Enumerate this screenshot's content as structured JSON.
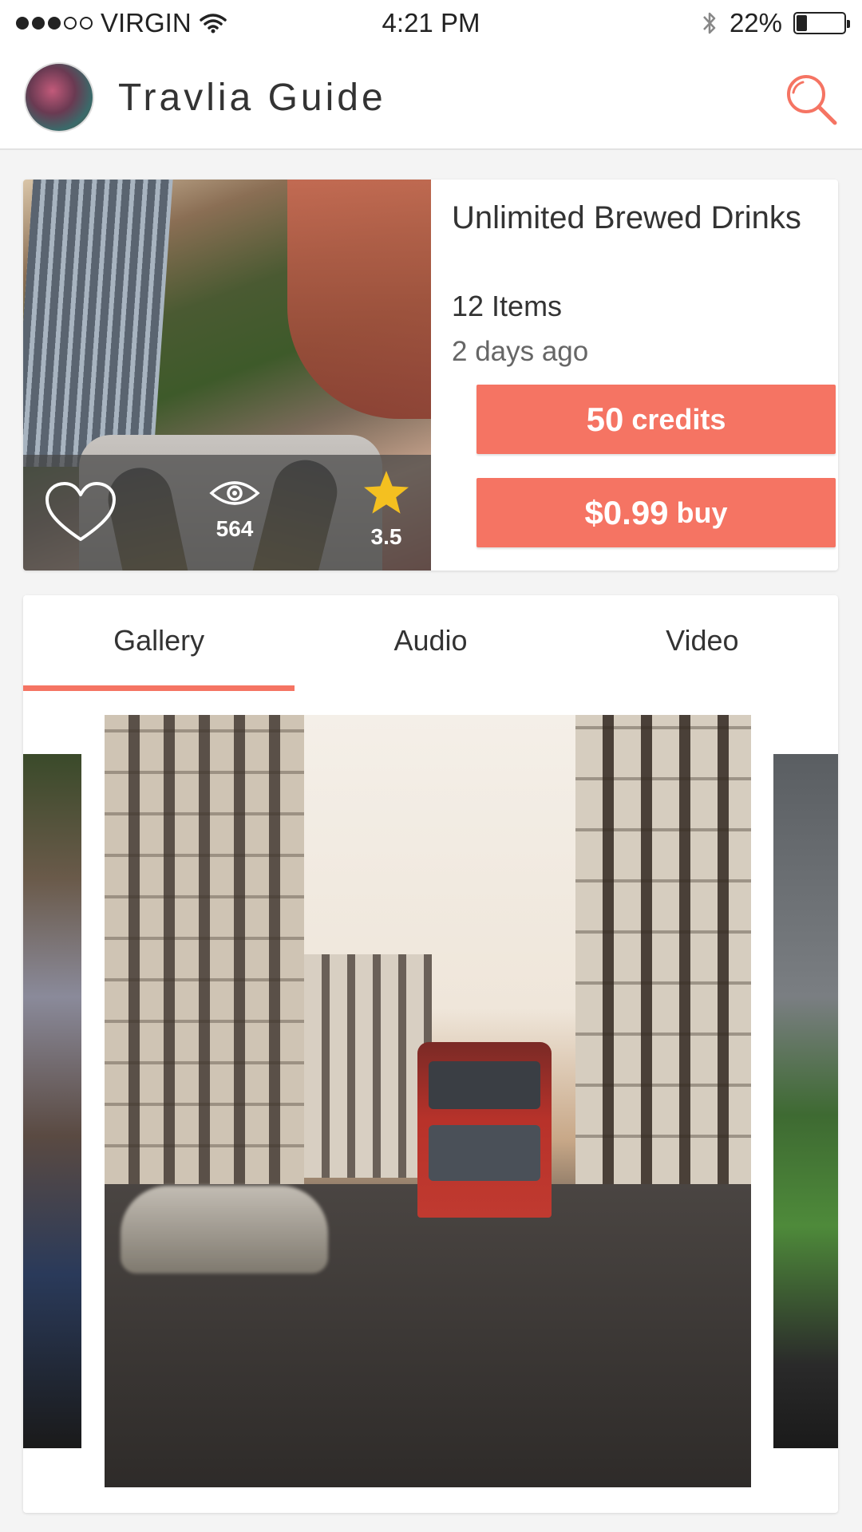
{
  "status_bar": {
    "signal_filled": 3,
    "signal_total": 5,
    "carrier": "VIRGIN",
    "time": "4:21 PM",
    "battery": "22%",
    "battery_level": 0.22
  },
  "header": {
    "title": "Travlia Guide",
    "search_icon": "search-icon",
    "avatar_icon": "avatar"
  },
  "product": {
    "title": "Unlimited Brewed Drinks",
    "items": "12 Items",
    "posted": "2 days ago",
    "views": "564",
    "rating": "3.5",
    "credits_value": "50",
    "credits_unit": "credits",
    "price_value": "$0.99",
    "price_unit": "buy"
  },
  "tabs": [
    {
      "label": "Gallery",
      "active": true
    },
    {
      "label": "Audio",
      "active": false
    },
    {
      "label": "Video",
      "active": false
    }
  ],
  "colors": {
    "accent": "#f57463",
    "star": "#f4c020",
    "text": "#333333"
  }
}
